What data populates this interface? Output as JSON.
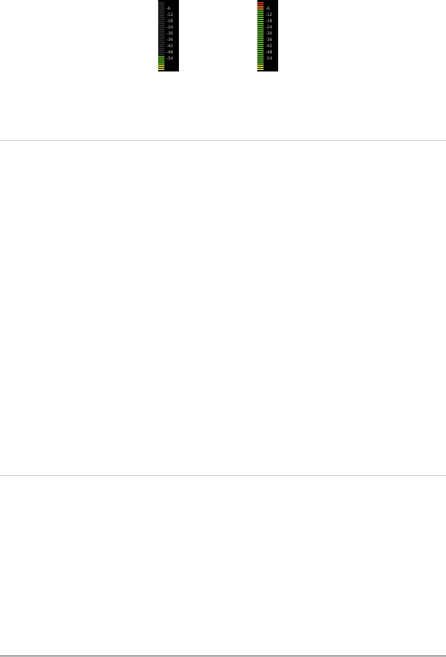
{
  "meters": [
    {
      "name": "left-level-meter",
      "level": 0.22,
      "peak_red": false,
      "scale": [
        "-6",
        "-12",
        "-18",
        "-24",
        "-30",
        "-36",
        "-42",
        "-48",
        "-54"
      ]
    },
    {
      "name": "right-level-meter",
      "level": 1.0,
      "peak_red": true,
      "scale": [
        "-6",
        "-12",
        "-18",
        "-24",
        "-30",
        "-36",
        "-42",
        "-48",
        "-54"
      ]
    }
  ],
  "colors": {
    "meter_background": "#000000",
    "segment_off": "#2a2d2f",
    "segment_green": "#5cae2b",
    "segment_yellow": "#c2cf3a",
    "segment_orange": "#d8832a",
    "segment_red": "#c9361f",
    "scale_text": "#b9b9b9",
    "divider": "#c8c8c8"
  }
}
